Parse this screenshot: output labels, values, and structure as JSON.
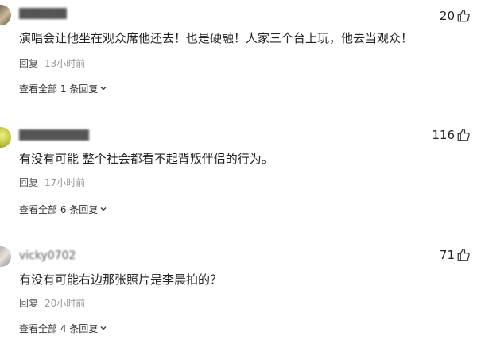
{
  "comments": [
    {
      "username": "█████████",
      "content": "演唱会让他坐在观众席他还去！也是硬融！人家三个台上玩，他去当观众！",
      "reply_label": "回复",
      "time": "13小时前",
      "view_replies": "查看全部 1 条回复",
      "likes": "20"
    },
    {
      "username": "██████████",
      "content": "有没有可能 整个社会都看不起背叛伴侣的行为。",
      "reply_label": "回复",
      "time": "17小时前",
      "view_replies": "查看全部 6 条回复",
      "likes": "116"
    },
    {
      "username": "vicky0702",
      "content": "有没有可能右边那张照片是李晨拍的？",
      "reply_label": "回复",
      "time": "20小时前",
      "view_replies": "查看全部 4 条回复",
      "likes": "71"
    }
  ],
  "icons": {
    "like": "thumbs-up-icon",
    "expand": "chevron-down-icon"
  },
  "colors": {
    "text": "#222222",
    "meta": "#888888",
    "link": "#333333"
  }
}
